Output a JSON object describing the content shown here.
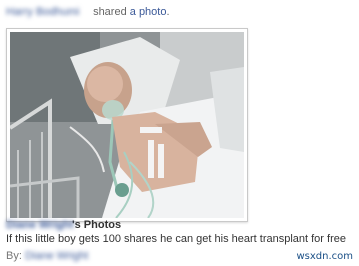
{
  "story": {
    "actor_name": "Harry Bodhumi",
    "action_text": "shared",
    "object_link": "a photo",
    "object_suffix": "."
  },
  "photo": {
    "album_owner": "Diane Wright",
    "album_suffix": "'s Photos",
    "caption": "If this little boy gets 100 shares he can get his heart transplant for free",
    "by_label": "By:",
    "by_name": "Diane Wright"
  },
  "watermark": "wsxdn.com",
  "colors": {
    "link": "#3b5998",
    "text": "#333333",
    "muted": "#777777"
  }
}
